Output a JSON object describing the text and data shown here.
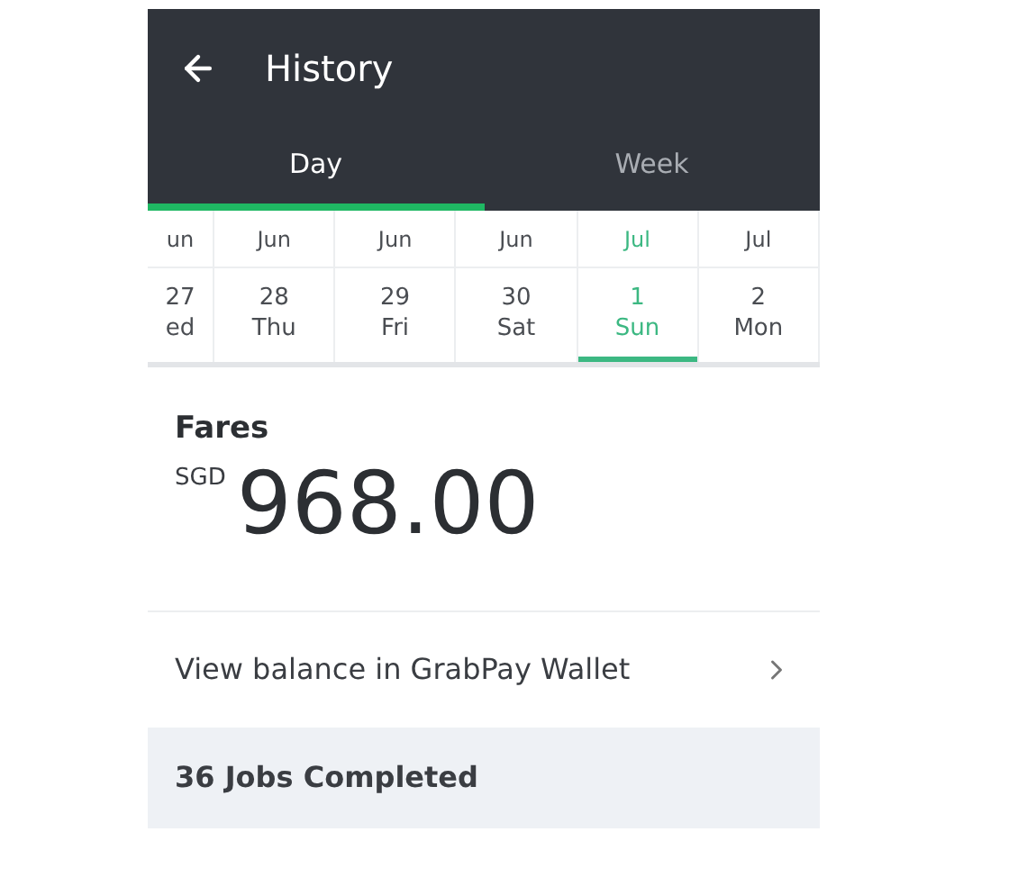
{
  "header": {
    "title": "History"
  },
  "tabs": [
    {
      "label": "Day",
      "selected": true
    },
    {
      "label": "Week",
      "selected": false
    }
  ],
  "dates": [
    {
      "kind": "partial",
      "month": "un",
      "day": "27",
      "weekday": "ed",
      "selected": false
    },
    {
      "kind": "full",
      "month": "Jun",
      "day": "28",
      "weekday": "Thu",
      "selected": false
    },
    {
      "kind": "full",
      "month": "Jun",
      "day": "29",
      "weekday": "Fri",
      "selected": false
    },
    {
      "kind": "full",
      "month": "Jun",
      "day": "30",
      "weekday": "Sat",
      "selected": false
    },
    {
      "kind": "full",
      "month": "Jul",
      "day": "1",
      "weekday": "Sun",
      "selected": true
    },
    {
      "kind": "full",
      "month": "Jul",
      "day": "2",
      "weekday": "Mon",
      "selected": false
    }
  ],
  "fares": {
    "title": "Fares",
    "currency": "SGD",
    "amount": "968.00"
  },
  "wallet_link": {
    "label": "View balance in GrabPay Wallet"
  },
  "jobs": {
    "label": "36 Jobs Completed"
  }
}
